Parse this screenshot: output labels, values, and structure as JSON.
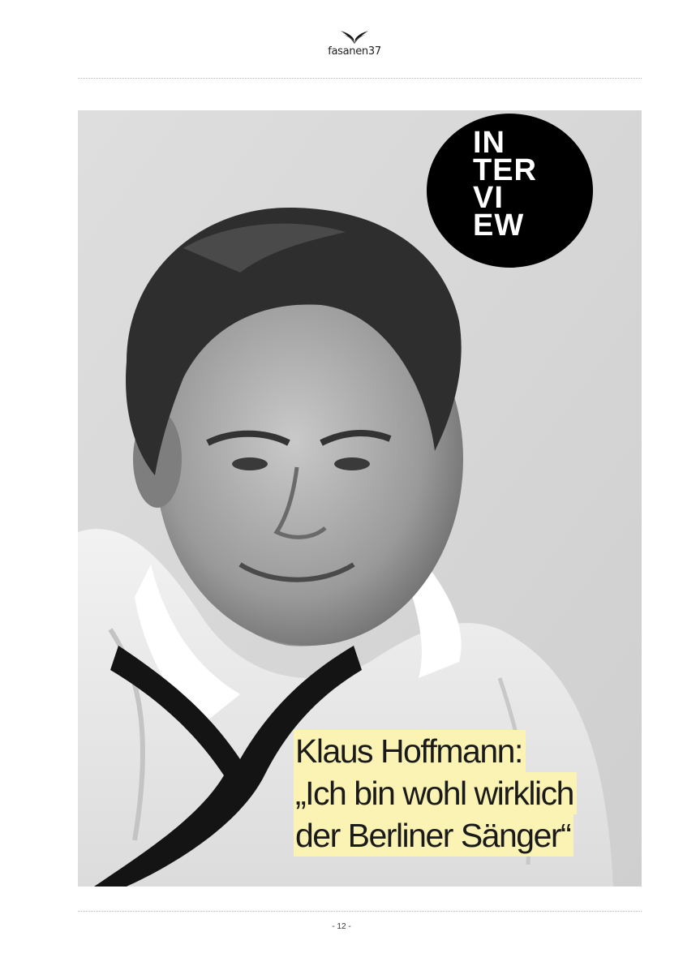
{
  "header": {
    "logo_text": "fasanen37",
    "logo_icon": "wings-icon"
  },
  "badge": {
    "lines": [
      "IN",
      "TER",
      "VI",
      "EW"
    ]
  },
  "photo": {
    "subject": "portrait-photo"
  },
  "headline": {
    "line1": "Klaus Hoffmann:",
    "line2": "„Ich bin wohl wirklich",
    "line3": "der Berliner Sänger“",
    "highlight_color": "#faf3b4"
  },
  "footer": {
    "page_number": "- 12 -"
  }
}
